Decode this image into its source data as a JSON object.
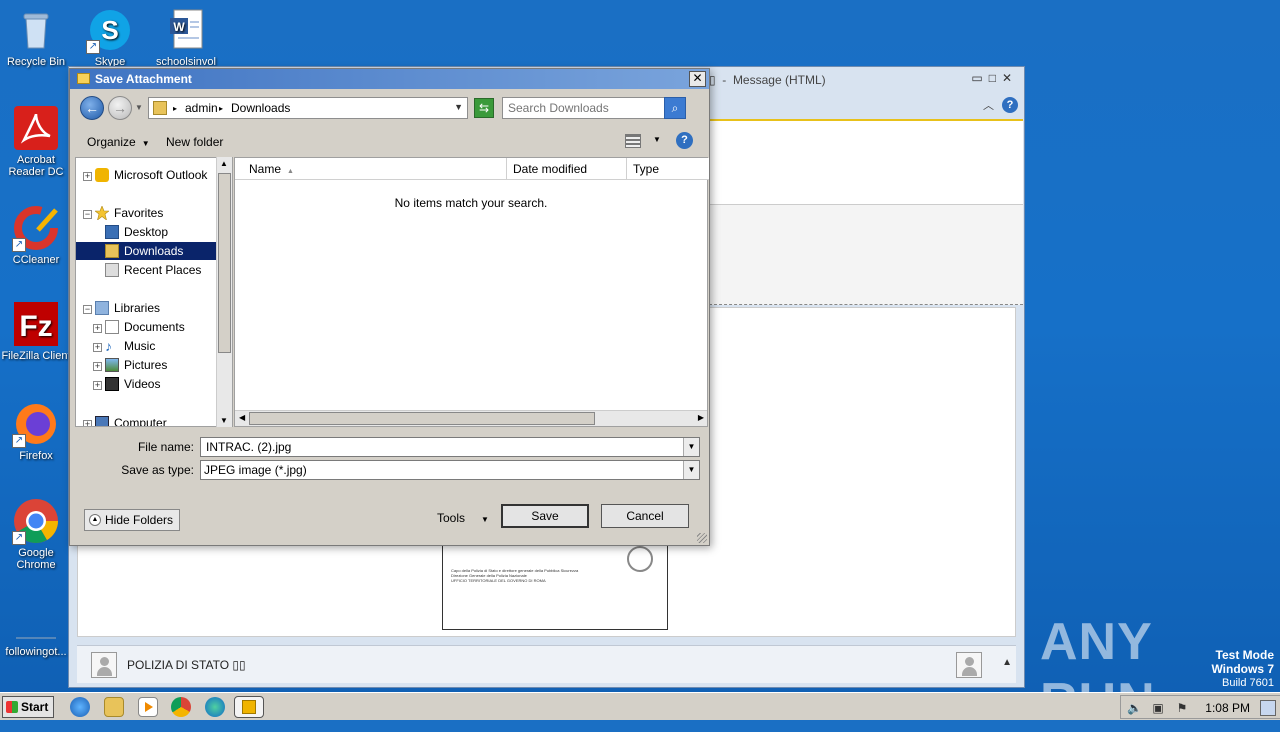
{
  "desktop": {
    "icons": [
      {
        "label": "Recycle Bin",
        "icon": "recycle-bin-icon"
      },
      {
        "label": "Skype",
        "icon": "skype-icon"
      },
      {
        "label": "schoolsinvol",
        "icon": "word-document-icon"
      },
      {
        "label": "Acrobat Reader DC",
        "icon": "acrobat-icon"
      },
      {
        "label": "CCleaner",
        "icon": "ccleaner-icon"
      },
      {
        "label": "FileZilla Client",
        "icon": "filezilla-icon"
      },
      {
        "label": "Firefox",
        "icon": "firefox-icon"
      },
      {
        "label": "Google Chrome",
        "icon": "chrome-icon"
      },
      {
        "label": "followingot...",
        "icon": "file-icon"
      }
    ],
    "watermark": "ANY RUN",
    "test_mode": {
      "line1": "Test Mode",
      "line2": "Windows 7",
      "line3": "Build 7601"
    }
  },
  "message_window": {
    "title": "Message (HTML)",
    "sender_name": "POLIZIA DI STATO ▯▯"
  },
  "dialog": {
    "title": "Save Attachment",
    "address": {
      "segment1": "admin",
      "segment2": "Downloads"
    },
    "search_placeholder": "Search Downloads",
    "toolbar": {
      "organize": "Organize",
      "new_folder": "New folder"
    },
    "tree": {
      "outlook": "Microsoft Outlook",
      "favorites": "Favorites",
      "desktop": "Desktop",
      "downloads": "Downloads",
      "recent_places": "Recent Places",
      "libraries": "Libraries",
      "documents": "Documents",
      "music": "Music",
      "pictures": "Pictures",
      "videos": "Videos",
      "computer": "Computer"
    },
    "columns": {
      "name": "Name",
      "date_modified": "Date modified",
      "type": "Type"
    },
    "empty_message": "No items match your search.",
    "file_name_label": "File name:",
    "file_name_value": "INTRAC. (2).jpg",
    "save_as_type_label": "Save as type:",
    "save_as_type_value": "JPEG image (*.jpg)",
    "hide_folders": "Hide Folders",
    "tools": "Tools",
    "save": "Save",
    "cancel": "Cancel"
  },
  "taskbar": {
    "start": "Start",
    "clock": "1:08 PM"
  }
}
